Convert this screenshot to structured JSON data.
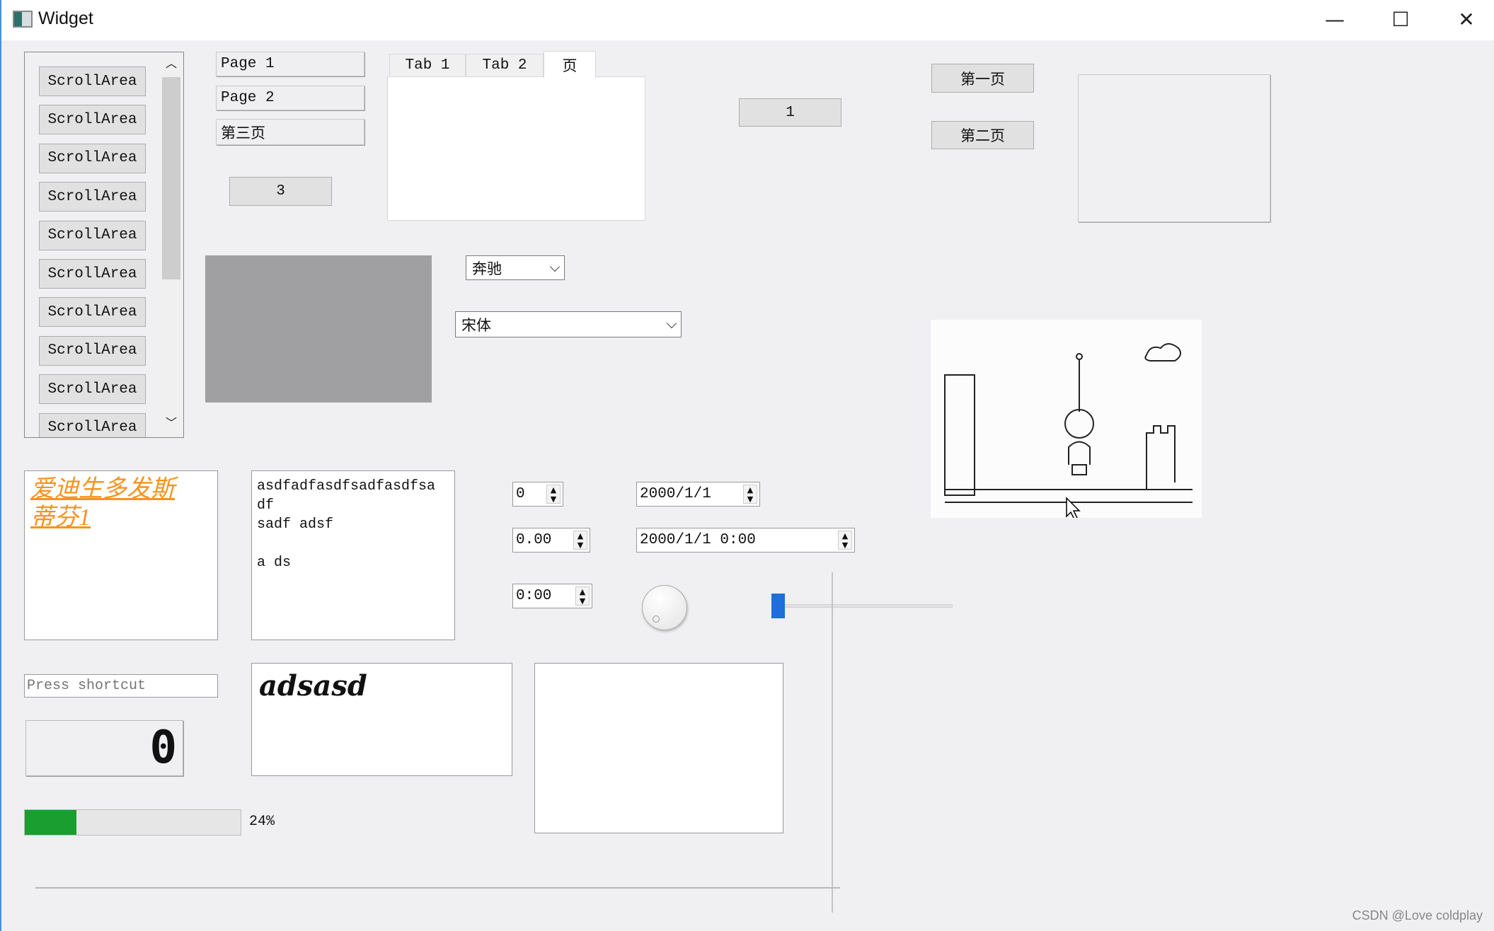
{
  "window": {
    "title": "Widget",
    "minimize": "—",
    "maximize": "☐",
    "close": "✕"
  },
  "scroll_area": {
    "items": [
      "ScrollArea",
      "ScrollArea",
      "ScrollArea",
      "ScrollArea",
      "ScrollArea",
      "ScrollArea",
      "ScrollArea",
      "ScrollArea",
      "ScrollArea",
      "ScrollArea"
    ],
    "up": "︿",
    "down": "﹀"
  },
  "toolbox": {
    "pages": [
      "Page 1",
      "Page 2",
      "第三页"
    ],
    "button": "3"
  },
  "tabs": {
    "items": [
      "Tab 1",
      "Tab 2",
      "页"
    ],
    "selected": 2
  },
  "stack_button": "1",
  "page_buttons": [
    "第一页",
    "第二页"
  ],
  "combo_car": {
    "value": "奔驰"
  },
  "combo_font": {
    "value": "宋体"
  },
  "label_link": {
    "line1": "爱迪生多发斯",
    "line2": "蒂芬1"
  },
  "text_edit": {
    "lines": [
      "asdfadfasdfsadfasdfsa",
      "df",
      "sadf adsf",
      "",
      "a ds"
    ]
  },
  "spin_int": {
    "value": "0"
  },
  "spin_double": {
    "value": "0.00"
  },
  "time_edit": {
    "value": "0:00"
  },
  "date_edit": {
    "value": "2000/1/1"
  },
  "datetime_edit": {
    "value": "2000/1/1 0:00"
  },
  "key_sequence": {
    "placeholder": "Press shortcut"
  },
  "lcd": {
    "value": "0"
  },
  "rich_text": {
    "value": "adsasd"
  },
  "progress": {
    "value": 24,
    "label": "24%",
    "color": "#1a9e2f"
  },
  "slider": {
    "value": 0,
    "color": "#1e6fd9"
  },
  "watermark": "CSDN @Love coldplay",
  "colors": {
    "link": "#f7931e",
    "gray_box": "#a0a0a2"
  }
}
